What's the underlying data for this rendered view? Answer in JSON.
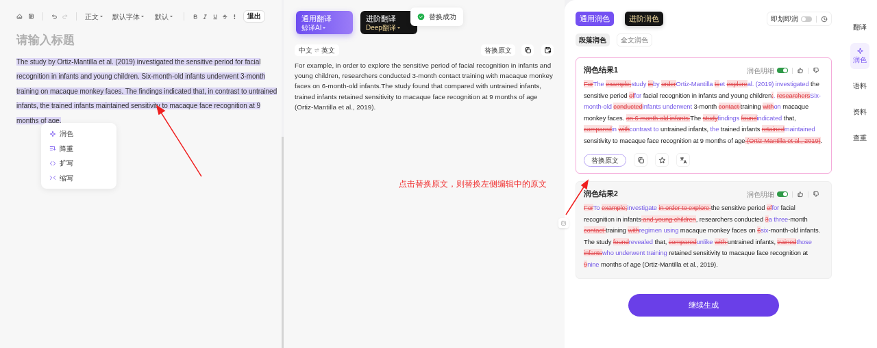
{
  "editor": {
    "toolbar": {
      "style": "正文",
      "font": "默认字体",
      "size": "默认",
      "exit": "退出"
    },
    "title_placeholder": "请输入标题",
    "text": "The study by Ortiz-Mantilla et al. (2019) investigated the sensitive period for facial recognition in infants and young children. Six-month-old infants underwent 3-month training on macaque monkey faces. The findings indicated that, in contrast to untrained infants, the trained infants maintained sensitivity to macaque face recognition at 9 months of age.",
    "selected": true,
    "context_menu": [
      {
        "label": "润色"
      },
      {
        "label": "降重"
      },
      {
        "label": "扩写"
      },
      {
        "label": "缩写"
      }
    ]
  },
  "translation": {
    "tabs": [
      {
        "title": "通用翻译",
        "engine": "鲸译AI",
        "selected": true
      },
      {
        "title": "进阶翻译",
        "engine": "Deep翻译",
        "selected": false
      }
    ],
    "toast": "替换成功",
    "languages": {
      "from": "中文",
      "to": "英文"
    },
    "replace": "替换原文",
    "text": "For example, in order to explore the sensitive period of facial recognition in infants and young children, researchers conducted 3-month contact training with macaque monkey faces on 6-month-old infants.The study found that compared with untrained infants, trained infants retained sensitivity to macaque face recognition at 9 months of age (Ortiz-Mantilla et al., 2019)."
  },
  "polish": {
    "tabs": [
      {
        "label": "通用润色",
        "selected": true
      },
      {
        "label": "进阶润色",
        "selected": false
      }
    ],
    "instant": {
      "label": "即划即润",
      "on": false
    },
    "modes": [
      {
        "label": "段落润色",
        "selected": true
      },
      {
        "label": "全文润色",
        "selected": false
      }
    ],
    "results": [
      {
        "title": "润色结果1",
        "detail_label": "润色明细",
        "detail_on": true,
        "selected": true,
        "replace": "替换原文",
        "segments": [
          {
            "kind": "del",
            "text": "For"
          },
          {
            "kind": "ins",
            "text": "The "
          },
          {
            "kind": "del",
            "text": "example;"
          },
          {
            "kind": "ins",
            "text": "study "
          },
          {
            "kind": "del",
            "text": "in"
          },
          {
            "kind": "ins",
            "text": "by "
          },
          {
            "kind": "del",
            "text": "order"
          },
          {
            "kind": "ins",
            "text": "Ortiz-Mantilla "
          },
          {
            "kind": "del",
            "text": "to"
          },
          {
            "kind": "ins",
            "text": "et "
          },
          {
            "kind": "del",
            "text": "explore"
          },
          {
            "kind": "ins",
            "text": "al. (2019) investigated"
          },
          {
            "kind": "same",
            "text": " the sensitive period "
          },
          {
            "kind": "del",
            "text": "of"
          },
          {
            "kind": "ins",
            "text": "for"
          },
          {
            "kind": "same",
            "text": " facial recognition in infants and young children"
          },
          {
            "kind": "del",
            "text": ":"
          },
          {
            "kind": "ins",
            "text": ". "
          },
          {
            "kind": "del",
            "text": "researchers"
          },
          {
            "kind": "ins",
            "text": "Six-month-old "
          },
          {
            "kind": "del",
            "text": "conducted"
          },
          {
            "kind": "ins",
            "text": "infants underwent"
          },
          {
            "kind": "same",
            "text": " 3-month "
          },
          {
            "kind": "del",
            "text": "contact "
          },
          {
            "kind": "same",
            "text": "training "
          },
          {
            "kind": "del",
            "text": "with"
          },
          {
            "kind": "ins",
            "text": "on"
          },
          {
            "kind": "same",
            "text": " macaque monkey faces. "
          },
          {
            "kind": "del",
            "text": "on 6-month-old infants."
          },
          {
            "kind": "same",
            "text": "The "
          },
          {
            "kind": "del",
            "text": "study"
          },
          {
            "kind": "ins",
            "text": "findings "
          },
          {
            "kind": "del",
            "text": "found"
          },
          {
            "kind": "ins",
            "text": "indicated"
          },
          {
            "kind": "same",
            "text": " that, "
          },
          {
            "kind": "del",
            "text": "compared"
          },
          {
            "kind": "ins",
            "text": "in "
          },
          {
            "kind": "del",
            "text": "with"
          },
          {
            "kind": "ins",
            "text": "contrast to"
          },
          {
            "kind": "same",
            "text": " untrained infants, "
          },
          {
            "kind": "ins",
            "text": "the"
          },
          {
            "kind": "same",
            "text": " trained infants "
          },
          {
            "kind": "del",
            "text": "retained"
          },
          {
            "kind": "ins",
            "text": "maintained"
          },
          {
            "kind": "same",
            "text": " sensitivity to macaque face recognition at 9 months of age"
          },
          {
            "kind": "del",
            "text": " (Ortiz-Mantilla et al., 2019)"
          },
          {
            "kind": "same",
            "text": "."
          }
        ]
      },
      {
        "title": "润色结果2",
        "detail_label": "润色明细",
        "detail_on": true,
        "selected": false,
        "segments": [
          {
            "kind": "del",
            "text": "For"
          },
          {
            "kind": "ins",
            "text": "To "
          },
          {
            "kind": "del",
            "text": "example;"
          },
          {
            "kind": "ins",
            "text": "investigate "
          },
          {
            "kind": "del",
            "text": "in order to explore "
          },
          {
            "kind": "same",
            "text": "the sensitive period "
          },
          {
            "kind": "del",
            "text": "of"
          },
          {
            "kind": "ins",
            "text": "for"
          },
          {
            "kind": "same",
            "text": " facial recognition in infants"
          },
          {
            "kind": "del",
            "text": " and young children"
          },
          {
            "kind": "same",
            "text": ", researchers conducted "
          },
          {
            "kind": "del",
            "text": "3"
          },
          {
            "kind": "ins",
            "text": "a three"
          },
          {
            "kind": "same",
            "text": "-month "
          },
          {
            "kind": "del",
            "text": "contact "
          },
          {
            "kind": "same",
            "text": "training "
          },
          {
            "kind": "del",
            "text": "with"
          },
          {
            "kind": "ins",
            "text": "regimen using"
          },
          {
            "kind": "same",
            "text": " macaque monkey faces on "
          },
          {
            "kind": "del",
            "text": "6"
          },
          {
            "kind": "ins",
            "text": "six"
          },
          {
            "kind": "same",
            "text": "-month-old infants. The study "
          },
          {
            "kind": "del",
            "text": "found"
          },
          {
            "kind": "ins",
            "text": "revealed"
          },
          {
            "kind": "same",
            "text": " that, "
          },
          {
            "kind": "del",
            "text": "compared"
          },
          {
            "kind": "ins",
            "text": "unlike "
          },
          {
            "kind": "del",
            "text": "with "
          },
          {
            "kind": "same",
            "text": "untrained infants, "
          },
          {
            "kind": "del",
            "text": "trained"
          },
          {
            "kind": "ins",
            "text": "those "
          },
          {
            "kind": "del",
            "text": "infants"
          },
          {
            "kind": "ins",
            "text": "who underwent training"
          },
          {
            "kind": "same",
            "text": " retained sensitivity to macaque face recognition at "
          },
          {
            "kind": "del",
            "text": "9"
          },
          {
            "kind": "ins",
            "text": "nine"
          },
          {
            "kind": "same",
            "text": " months of age (Ortiz-Mantilla et al., 2019)."
          }
        ]
      }
    ],
    "continue": "继续生成"
  },
  "sidebar": [
    {
      "label": "翻译",
      "selected": false
    },
    {
      "label": "润色",
      "selected": true
    },
    {
      "label": "语料",
      "selected": false
    },
    {
      "label": "资料",
      "selected": false
    },
    {
      "label": "查重",
      "selected": false
    }
  ],
  "annotation": "点击替换原文，则替换左侧编辑中的原文"
}
